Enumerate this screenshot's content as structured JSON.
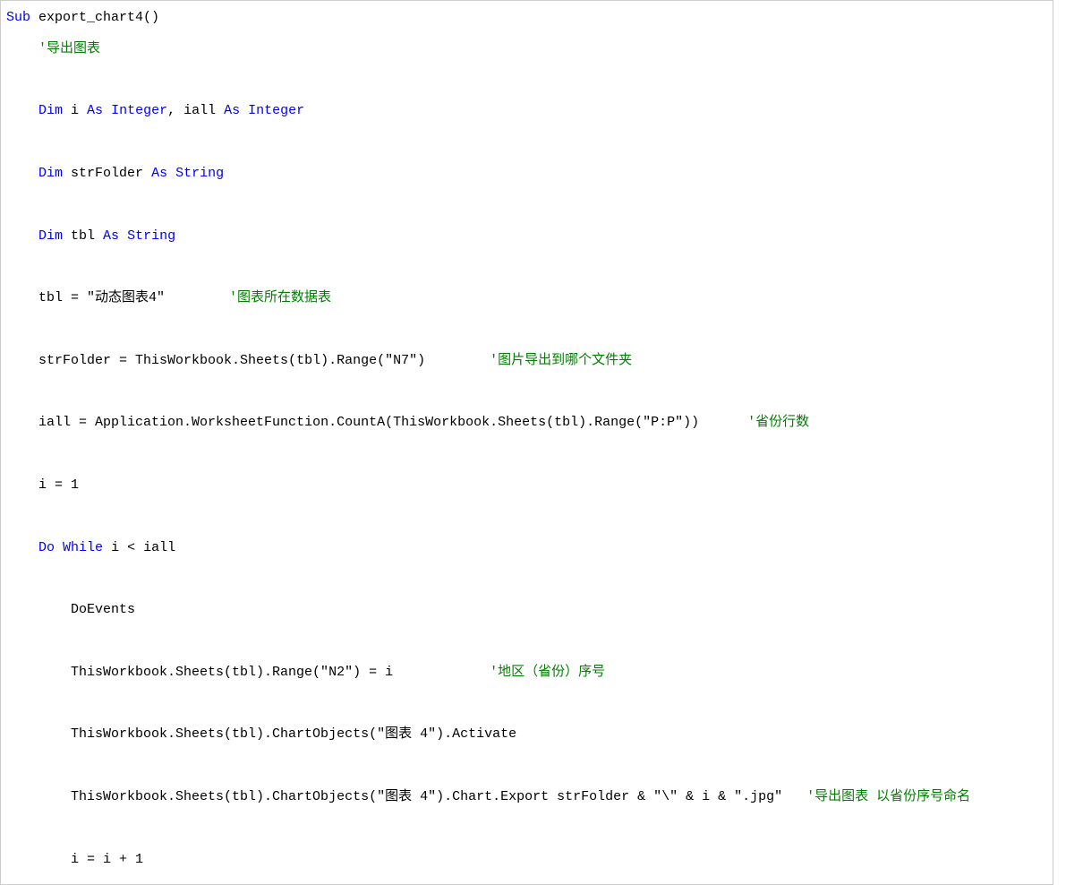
{
  "code": {
    "l1_kw1": "Sub",
    "l1_tx1": " export_chart4()",
    "l2_cm1": "'导出图表",
    "l3_kw1": "Dim",
    "l3_tx1": " i ",
    "l3_kw2": "As",
    "l3_tx2": " ",
    "l3_kw3": "Integer",
    "l3_tx3": ", iall ",
    "l3_kw4": "As",
    "l3_tx4": " ",
    "l3_kw5": "Integer",
    "l4_kw1": "Dim",
    "l4_tx1": " strFolder ",
    "l4_kw2": "As",
    "l4_tx2": " ",
    "l4_kw3": "String",
    "l5_kw1": "Dim",
    "l5_tx1": " tbl ",
    "l5_kw2": "As",
    "l5_tx2": " ",
    "l5_kw3": "String",
    "l6_tx1": "tbl = \"动态图表4\"        ",
    "l6_cm1": "'图表所在数据表",
    "l7_tx1": "strFolder = ThisWorkbook.Sheets(tbl).Range(\"N7\")        ",
    "l7_cm1": "'图片导出到哪个文件夹",
    "l8_tx1": "iall = Application.WorksheetFunction.CountA(ThisWorkbook.Sheets(tbl).Range(\"P:P\"))      ",
    "l8_cm1": "'省份行数",
    "l9_tx1": "i = 1",
    "l10_kw1": "Do",
    "l10_tx1": " ",
    "l10_kw2": "While",
    "l10_tx2": " i < iall",
    "l11_tx1": "DoEvents",
    "l12_tx1": "ThisWorkbook.Sheets(tbl).Range(\"N2\") = i            ",
    "l12_cm1": "'地区（省份）序号",
    "l13_tx1": "ThisWorkbook.Sheets(tbl).ChartObjects(\"图表 4\").Activate",
    "l14_tx1": "ThisWorkbook.Sheets(tbl).ChartObjects(\"图表 4\").Chart.Export strFolder & \"\\\" & i & \".jpg\"   ",
    "l14_cm1": "'导出图表 以省份序号命名",
    "l15_tx1": "i = i + 1"
  }
}
